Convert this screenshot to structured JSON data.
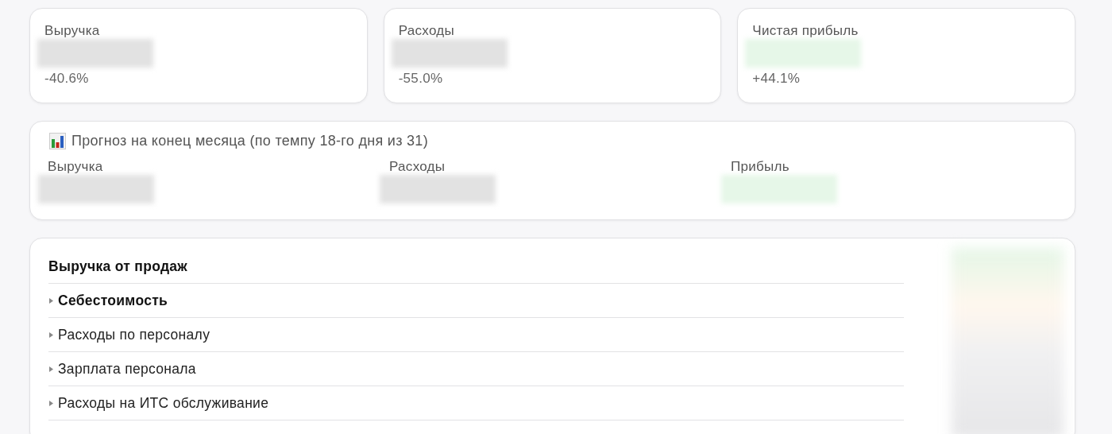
{
  "summary_cards": [
    {
      "label": "Выручка",
      "color": "#e2e2e2",
      "change": "-40.6%"
    },
    {
      "label": "Расходы",
      "color": "#e2e2e2",
      "change": "-55.0%"
    },
    {
      "label": "Чистая прибыль",
      "color": "#e6f7e8",
      "change": "+44.1%"
    }
  ],
  "forecast": {
    "title": "Прогноз на конец месяца (по темпу 18-го дня из 31)",
    "items": [
      {
        "label": "Выручка",
        "color": "#e2e2e2"
      },
      {
        "label": "Расходы",
        "color": "#e2e2e2"
      },
      {
        "label": "Прибыль",
        "color": "#e6f7e8"
      }
    ]
  },
  "report": {
    "rows": [
      {
        "kind": "header",
        "label": "Выручка от продаж"
      },
      {
        "kind": "group",
        "label": "Себестоимость",
        "expanded": false
      },
      {
        "kind": "item",
        "label": "Расходы по персоналу",
        "expanded": false
      },
      {
        "kind": "item",
        "label": "Зарплата персонала",
        "expanded": false
      },
      {
        "kind": "item",
        "label": "Расходы на ИТС обслуживание",
        "expanded": false
      }
    ]
  }
}
